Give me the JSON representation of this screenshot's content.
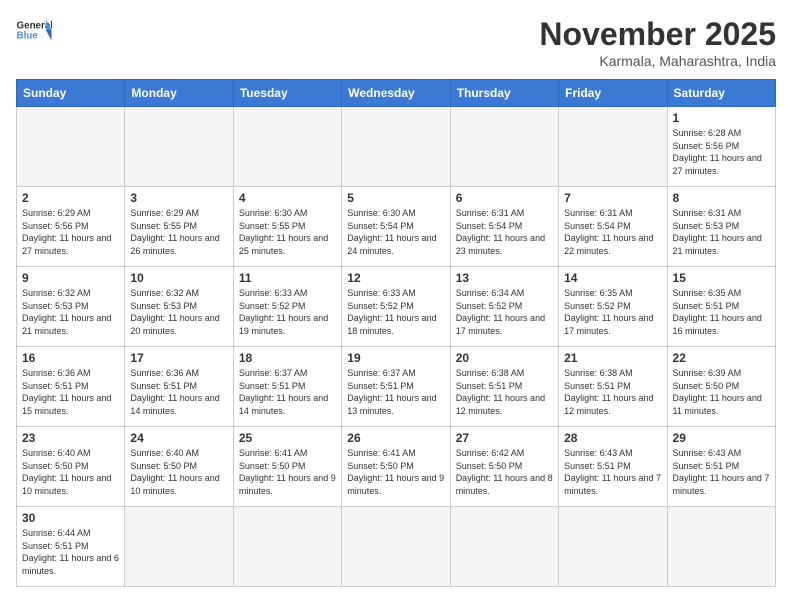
{
  "header": {
    "logo_general": "General",
    "logo_blue": "Blue",
    "month_title": "November 2025",
    "location": "Karmala, Maharashtra, India"
  },
  "weekdays": [
    "Sunday",
    "Monday",
    "Tuesday",
    "Wednesday",
    "Thursday",
    "Friday",
    "Saturday"
  ],
  "cells": [
    {
      "day": "",
      "empty": true
    },
    {
      "day": "",
      "empty": true
    },
    {
      "day": "",
      "empty": true
    },
    {
      "day": "",
      "empty": true
    },
    {
      "day": "",
      "empty": true
    },
    {
      "day": "",
      "empty": true
    },
    {
      "day": "1",
      "sunrise": "6:28 AM",
      "sunset": "5:56 PM",
      "daylight": "11 hours and 27 minutes."
    },
    {
      "day": "2",
      "sunrise": "6:29 AM",
      "sunset": "5:56 PM",
      "daylight": "11 hours and 27 minutes."
    },
    {
      "day": "3",
      "sunrise": "6:29 AM",
      "sunset": "5:55 PM",
      "daylight": "11 hours and 26 minutes."
    },
    {
      "day": "4",
      "sunrise": "6:30 AM",
      "sunset": "5:55 PM",
      "daylight": "11 hours and 25 minutes."
    },
    {
      "day": "5",
      "sunrise": "6:30 AM",
      "sunset": "5:54 PM",
      "daylight": "11 hours and 24 minutes."
    },
    {
      "day": "6",
      "sunrise": "6:31 AM",
      "sunset": "5:54 PM",
      "daylight": "11 hours and 23 minutes."
    },
    {
      "day": "7",
      "sunrise": "6:31 AM",
      "sunset": "5:54 PM",
      "daylight": "11 hours and 22 minutes."
    },
    {
      "day": "8",
      "sunrise": "6:31 AM",
      "sunset": "5:53 PM",
      "daylight": "11 hours and 21 minutes."
    },
    {
      "day": "9",
      "sunrise": "6:32 AM",
      "sunset": "5:53 PM",
      "daylight": "11 hours and 21 minutes."
    },
    {
      "day": "10",
      "sunrise": "6:32 AM",
      "sunset": "5:53 PM",
      "daylight": "11 hours and 20 minutes."
    },
    {
      "day": "11",
      "sunrise": "6:33 AM",
      "sunset": "5:52 PM",
      "daylight": "11 hours and 19 minutes."
    },
    {
      "day": "12",
      "sunrise": "6:33 AM",
      "sunset": "5:52 PM",
      "daylight": "11 hours and 18 minutes."
    },
    {
      "day": "13",
      "sunrise": "6:34 AM",
      "sunset": "5:52 PM",
      "daylight": "11 hours and 17 minutes."
    },
    {
      "day": "14",
      "sunrise": "6:35 AM",
      "sunset": "5:52 PM",
      "daylight": "11 hours and 17 minutes."
    },
    {
      "day": "15",
      "sunrise": "6:35 AM",
      "sunset": "5:51 PM",
      "daylight": "11 hours and 16 minutes."
    },
    {
      "day": "16",
      "sunrise": "6:36 AM",
      "sunset": "5:51 PM",
      "daylight": "11 hours and 15 minutes."
    },
    {
      "day": "17",
      "sunrise": "6:36 AM",
      "sunset": "5:51 PM",
      "daylight": "11 hours and 14 minutes."
    },
    {
      "day": "18",
      "sunrise": "6:37 AM",
      "sunset": "5:51 PM",
      "daylight": "11 hours and 14 minutes."
    },
    {
      "day": "19",
      "sunrise": "6:37 AM",
      "sunset": "5:51 PM",
      "daylight": "11 hours and 13 minutes."
    },
    {
      "day": "20",
      "sunrise": "6:38 AM",
      "sunset": "5:51 PM",
      "daylight": "11 hours and 12 minutes."
    },
    {
      "day": "21",
      "sunrise": "6:38 AM",
      "sunset": "5:51 PM",
      "daylight": "11 hours and 12 minutes."
    },
    {
      "day": "22",
      "sunrise": "6:39 AM",
      "sunset": "5:50 PM",
      "daylight": "11 hours and 11 minutes."
    },
    {
      "day": "23",
      "sunrise": "6:40 AM",
      "sunset": "5:50 PM",
      "daylight": "11 hours and 10 minutes."
    },
    {
      "day": "24",
      "sunrise": "6:40 AM",
      "sunset": "5:50 PM",
      "daylight": "11 hours and 10 minutes."
    },
    {
      "day": "25",
      "sunrise": "6:41 AM",
      "sunset": "5:50 PM",
      "daylight": "11 hours and 9 minutes."
    },
    {
      "day": "26",
      "sunrise": "6:41 AM",
      "sunset": "5:50 PM",
      "daylight": "11 hours and 9 minutes."
    },
    {
      "day": "27",
      "sunrise": "6:42 AM",
      "sunset": "5:50 PM",
      "daylight": "11 hours and 8 minutes."
    },
    {
      "day": "28",
      "sunrise": "6:43 AM",
      "sunset": "5:51 PM",
      "daylight": "11 hours and 7 minutes."
    },
    {
      "day": "29",
      "sunrise": "6:43 AM",
      "sunset": "5:51 PM",
      "daylight": "11 hours and 7 minutes."
    },
    {
      "day": "30",
      "sunrise": "6:44 AM",
      "sunset": "5:51 PM",
      "daylight": "11 hours and 6 minutes."
    },
    {
      "day": "",
      "empty": true
    },
    {
      "day": "",
      "empty": true
    },
    {
      "day": "",
      "empty": true
    },
    {
      "day": "",
      "empty": true
    },
    {
      "day": "",
      "empty": true
    },
    {
      "day": "",
      "empty": true
    }
  ]
}
